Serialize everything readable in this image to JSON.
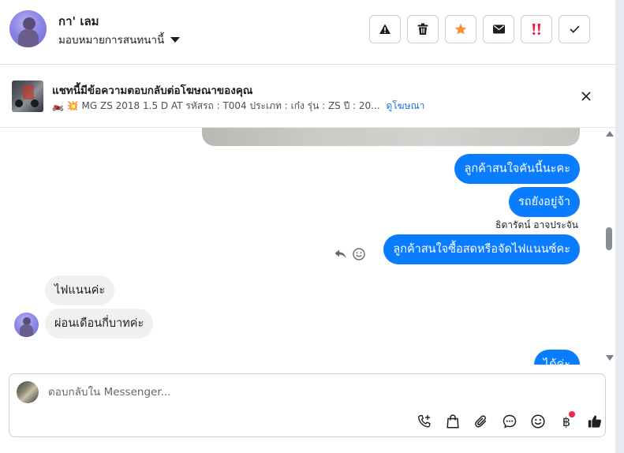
{
  "header": {
    "contact_name": "กา' เลม",
    "assign_label": "มอบหมายการสนทนานี้",
    "actions": [
      {
        "name": "report",
        "icon": "warning-icon"
      },
      {
        "name": "delete",
        "icon": "trash-icon"
      },
      {
        "name": "star",
        "icon": "star-icon",
        "color": "#f7923b"
      },
      {
        "name": "mark-unread",
        "icon": "envelope-icon"
      },
      {
        "name": "spam",
        "icon": "double-exclamation-icon",
        "color": "#e41e3f"
      },
      {
        "name": "done",
        "icon": "check-icon"
      }
    ]
  },
  "ad": {
    "title": "แชทนี้มีข้อความตอบกลับต่อโฆษณาของคุณ",
    "emoji": "🏍️ 💥",
    "subtitle": "MG ZS 2018 1.5 D AT รหัสรถ : T004 ประเภท : เก๋ง รุ่น : ZS ปี : 20...",
    "link": "ดูโฆษณา"
  },
  "messages": [
    {
      "dir": "out",
      "text": "ลูกค้าสนใจคันนี้นะคะ"
    },
    {
      "dir": "out",
      "text": "รถยังอยู่จ้า"
    },
    {
      "sender": "ธิดารัตน์ อาจประจัน"
    },
    {
      "dir": "out",
      "text": "ลูกค้าสนใจซื้อสดหรือจัดไฟแนนซ์คะ"
    },
    {
      "dir": "in",
      "text": "ไฟแนนค่ะ"
    },
    {
      "dir": "in",
      "text": "ผ่อนเดือนกี่บาทค่ะ"
    },
    {
      "dir": "out",
      "text": "ได้ค่ะ"
    }
  ],
  "composer": {
    "placeholder": "ตอบกลับใน Messenger...",
    "currency_symbol": "฿",
    "tools": [
      "call-add-icon",
      "shopping-bag-icon",
      "paperclip-icon",
      "chat-bubble-icon",
      "emoji-icon",
      "baht-icon",
      "thumbs-up-icon"
    ],
    "notification_color": "#f02849"
  },
  "colors": {
    "outgoing_bubble": "#0a7cff",
    "incoming_bubble": "#f0f0f0",
    "link": "#216fdb"
  }
}
